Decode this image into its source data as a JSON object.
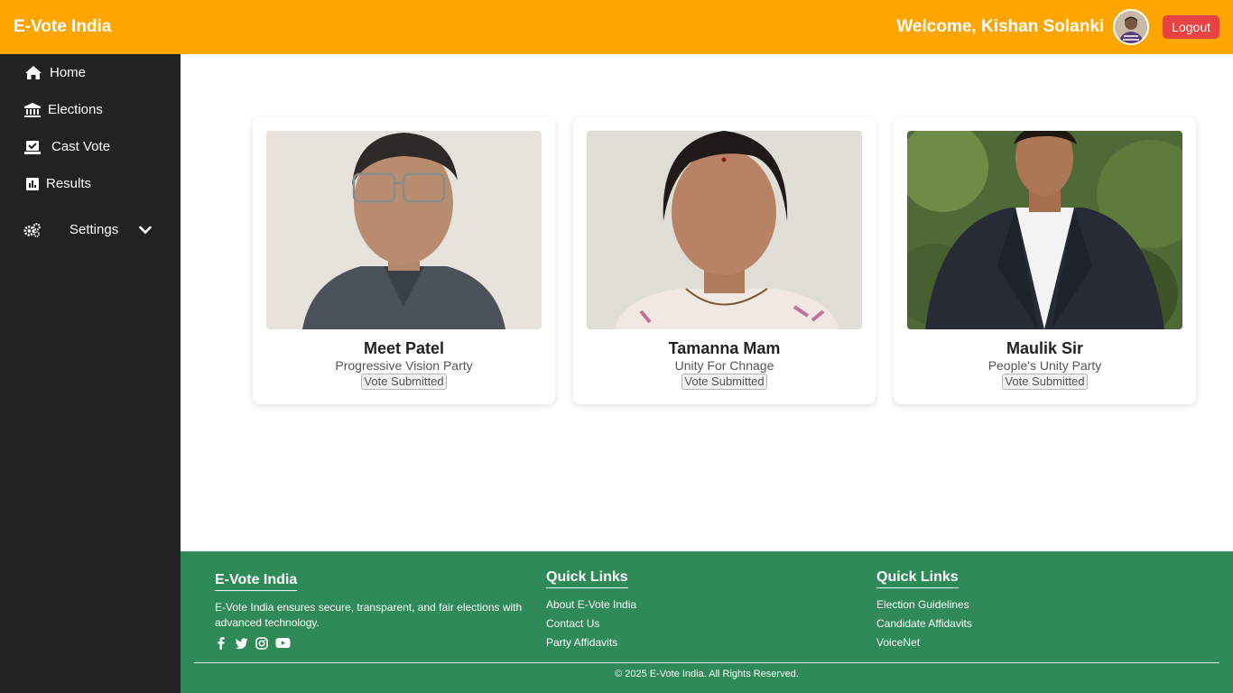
{
  "header": {
    "brand": "E-Vote India",
    "welcome": "Welcome, Kishan Solanki",
    "logout_label": "Logout",
    "bg_color": "#ffa500",
    "logout_color": "#e84343"
  },
  "sidebar": {
    "items": [
      {
        "label": "Home",
        "icon": "home-icon"
      },
      {
        "label": "Elections",
        "icon": "bank-icon"
      },
      {
        "label": "Cast Vote",
        "icon": "vote-box-icon"
      },
      {
        "label": "Results",
        "icon": "bar-chart-icon"
      },
      {
        "label": "Settings",
        "icon": "gears-icon"
      }
    ],
    "bg_color": "#222222"
  },
  "candidates": [
    {
      "name": "Meet Patel",
      "party": "Progressive Vision Party",
      "status": "Vote Submitted"
    },
    {
      "name": "Tamanna Mam",
      "party": "Unity For Chnage",
      "status": "Vote Submitted"
    },
    {
      "name": "Maulik Sir",
      "party": "People's Unity Party",
      "status": "Vote Submitted"
    }
  ],
  "footer": {
    "about_title": "E-Vote India",
    "about_text": "E-Vote India ensures secure, transparent, and fair elections with advanced technology.",
    "socials": [
      "facebook-icon",
      "twitter-icon",
      "instagram-icon",
      "youtube-icon"
    ],
    "col2_title": "Quick Links",
    "col2_links": [
      "About E-Vote India",
      "Contact Us",
      "Party Affidavits"
    ],
    "col3_title": "Quick Links",
    "col3_links": [
      "Election Guidelines",
      "Candidate Affidavits",
      "VoiceNet"
    ],
    "copyright": "© 2025 E-Vote India. All Rights Reserved.",
    "bg_color": "#2e8b57"
  }
}
